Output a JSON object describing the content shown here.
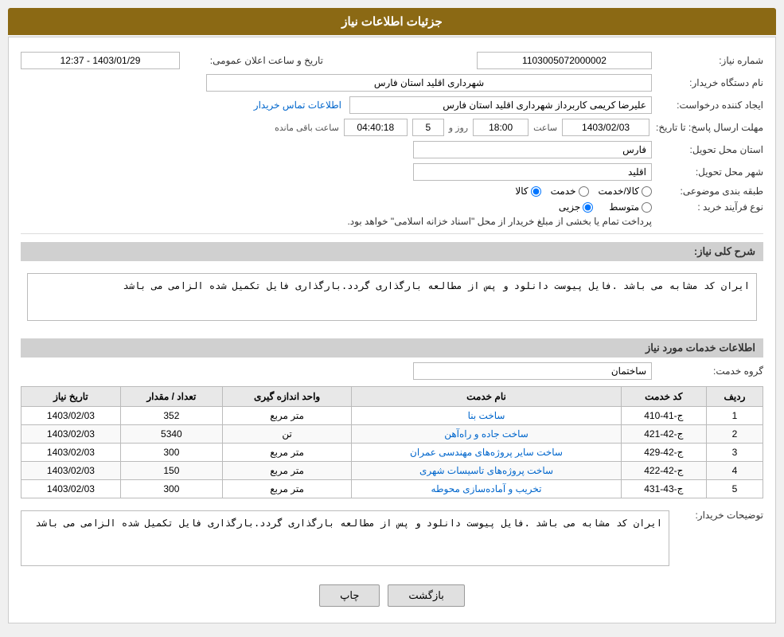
{
  "header": {
    "title": "جزئیات اطلاعات نیاز"
  },
  "fields": {
    "need_number_label": "شماره نیاز:",
    "need_number_value": "1103005072000002",
    "buyer_org_label": "نام دستگاه خریدار:",
    "buyer_org_value": "شهرداری اقلید استان فارس",
    "requester_label": "ایجاد کننده درخواست:",
    "requester_value": "علیرضا کریمی  کاربرداز شهرداری اقلید استان فارس",
    "contact_link": "اطلاعات تماس خریدار",
    "response_deadline_label": "مهلت ارسال پاسخ: تا تاریخ:",
    "response_date": "1403/02/03",
    "response_time_label": "ساعت",
    "response_time": "18:00",
    "remaining_label": "روز و",
    "remaining_days": "5",
    "remaining_time_label": "ساعت باقی مانده",
    "remaining_countdown": "04:40:18",
    "province_label": "استان محل تحویل:",
    "province_value": "فارس",
    "city_label": "شهر محل تحویل:",
    "city_value": "اقلید",
    "category_label": "طبقه بندی موضوعی:",
    "category_goods": "کالا",
    "category_service": "خدمت",
    "category_goods_service": "کالا/خدمت",
    "process_label": "نوع فرآیند خرید :",
    "process_part": "جزیی",
    "process_medium": "متوسط",
    "process_note": "پرداخت تمام یا بخشی از مبلغ خریدار از محل \"اسناد خزانه اسلامی\" خواهد بود.",
    "public_announce_label": "تاریخ و ساعت اعلان عمومی:",
    "public_announce_value": "1403/01/29 - 12:37",
    "description_label": "شرح کلی نیاز:",
    "description_value": "ایران کد مشابه می باشد .فایل پیوست دانلود و پس از مطالعه بارگذاری گردد.بارگذاری فایل تکمیل شده الزامی می باشد",
    "services_section_label": "اطلاعات خدمات مورد نیاز",
    "group_label": "گروه خدمت:",
    "group_value": "ساختمان",
    "table": {
      "headers": [
        "ردیف",
        "کد خدمت",
        "نام خدمت",
        "واحد اندازه گیری",
        "تعداد / مقدار",
        "تاریخ نیاز"
      ],
      "rows": [
        {
          "row": "1",
          "code": "ج-41-410",
          "name": "ساخت بنا",
          "unit": "متر مربع",
          "qty": "352",
          "date": "1403/02/03"
        },
        {
          "row": "2",
          "code": "ج-42-421",
          "name": "ساخت جاده و راه‌آهن",
          "unit": "تن",
          "qty": "5340",
          "date": "1403/02/03"
        },
        {
          "row": "3",
          "code": "ج-42-429",
          "name": "ساخت سایر پروژه‌های مهندسی عمران",
          "unit": "متر مربع",
          "qty": "300",
          "date": "1403/02/03"
        },
        {
          "row": "4",
          "code": "ج-42-422",
          "name": "ساخت پروژه‌های تاسیسات شهری",
          "unit": "متر مربع",
          "qty": "150",
          "date": "1403/02/03"
        },
        {
          "row": "5",
          "code": "ج-43-431",
          "name": "تخریب و آماده‌سازی محوطه",
          "unit": "متر مربع",
          "qty": "300",
          "date": "1403/02/03"
        }
      ]
    },
    "buyer_desc_label": "توضیحات خریدار:",
    "buyer_desc_value": "ایران کد مشابه می باشد .فایل پیوست دانلود و پس از مطالعه بارگذاری گردد.بارگذاری فایل تکمیل شده الزامی می باشد"
  },
  "buttons": {
    "print_label": "چاپ",
    "back_label": "بازگشت"
  }
}
